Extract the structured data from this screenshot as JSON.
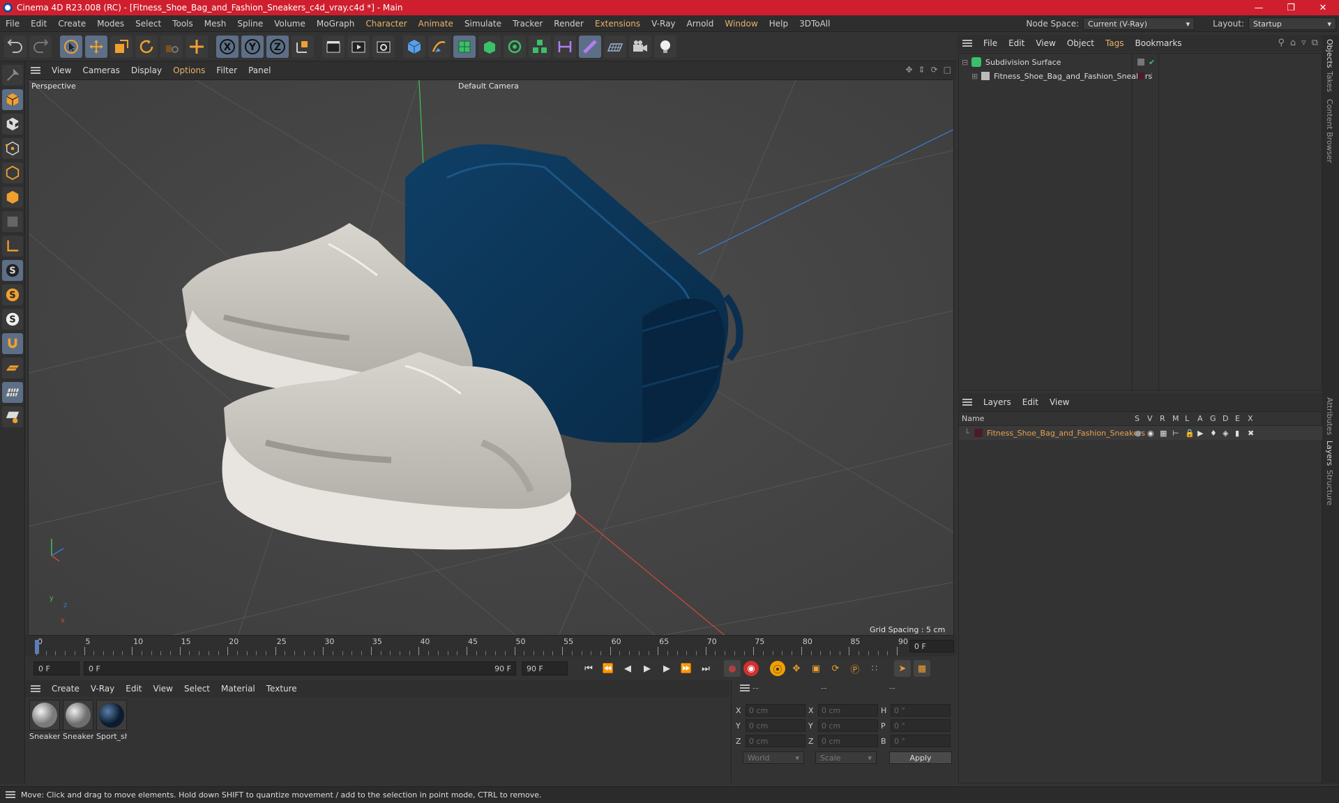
{
  "window": {
    "title": "Cinema 4D R23.008 (RC) - [Fitness_Shoe_Bag_and_Fashion_Sneakers_c4d_vray.c4d *] - Main"
  },
  "menubar": {
    "items": [
      "File",
      "Edit",
      "Create",
      "Modes",
      "Select",
      "Tools",
      "Mesh",
      "Spline",
      "Volume",
      "MoGraph",
      "Character",
      "Animate",
      "Simulate",
      "Tracker",
      "Render",
      "Extensions",
      "V-Ray",
      "Arnold",
      "Window",
      "Help",
      "3DToAll"
    ],
    "node_space_label": "Node Space:",
    "node_space_value": "Current (V-Ray)",
    "layout_label": "Layout:",
    "layout_value": "Startup"
  },
  "viewport": {
    "menu": [
      "View",
      "Cameras",
      "Display",
      "Options",
      "Filter",
      "Panel"
    ],
    "view_name": "Perspective",
    "camera": "Default Camera",
    "grid_spacing": "Grid Spacing : 5 cm",
    "axis_y": "y",
    "axis_z": "z",
    "axis_x": "x"
  },
  "timeline": {
    "ticks": [
      "0",
      "5",
      "10",
      "15",
      "20",
      "25",
      "30",
      "35",
      "40",
      "45",
      "50",
      "55",
      "60",
      "65",
      "70",
      "75",
      "80",
      "85",
      "90"
    ],
    "current_frame": "0 F",
    "start_frame": "0 F",
    "range_start": "0 F",
    "range_end": "90 F",
    "end_frame": "90 F"
  },
  "materials": {
    "menu": [
      "Create",
      "V-Ray",
      "Edit",
      "View",
      "Select",
      "Material",
      "Texture"
    ],
    "items": [
      "Sneakers",
      "Sneakers",
      "Sport_sh"
    ]
  },
  "coordinates": {
    "col_headers": [
      "--",
      "--",
      "--"
    ],
    "rows": [
      {
        "a1": "X",
        "v1": "0 cm",
        "a2": "X",
        "v2": "0 cm",
        "a3": "H",
        "v3": "0 °"
      },
      {
        "a1": "Y",
        "v1": "0 cm",
        "a2": "Y",
        "v2": "0 cm",
        "a3": "P",
        "v3": "0 °"
      },
      {
        "a1": "Z",
        "v1": "0 cm",
        "a2": "Z",
        "v2": "0 cm",
        "a3": "B",
        "v3": "0 °"
      }
    ],
    "mode": "World",
    "transform": "Scale",
    "apply": "Apply"
  },
  "object_manager": {
    "menu": [
      "File",
      "Edit",
      "View",
      "Object",
      "Tags",
      "Bookmarks"
    ],
    "objects": [
      "Subdivision Surface",
      "Fitness_Shoe_Bag_and_Fashion_Sneakers"
    ]
  },
  "layers": {
    "menu": [
      "Layers",
      "Edit",
      "View"
    ],
    "columns": [
      "Name",
      "S",
      "V",
      "R",
      "M",
      "L",
      "A",
      "G",
      "D",
      "E",
      "X"
    ],
    "rows": [
      "Fitness_Shoe_Bag_and_Fashion_Sneakers"
    ]
  },
  "side_tabs": [
    "Objects",
    "Takes",
    "Content Browser",
    "Attributes",
    "Layers",
    "Structure"
  ],
  "statusbar": {
    "text": "Move: Click and drag to move elements. Hold down SHIFT to quantize movement / add to the selection in point mode, CTRL to remove."
  },
  "colors": {
    "title_bar": "#cf1f2e",
    "accent_menu": "#e8b36a",
    "layer_name": "#e8a050",
    "bag": "#0d3556",
    "sneaker": "#cfcbc4"
  }
}
